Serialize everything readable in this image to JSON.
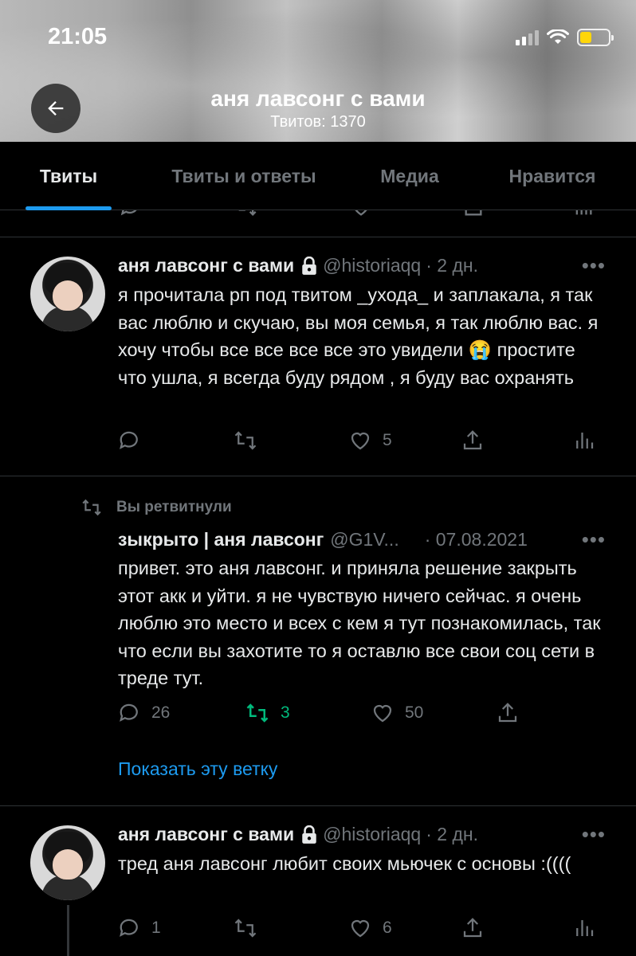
{
  "status_bar": {
    "time": "21:05"
  },
  "header": {
    "title": "аня лавсонг с вами",
    "subtitle": "Твитов: 1370"
  },
  "tabs": [
    {
      "label": "Твиты",
      "active": true
    },
    {
      "label": "Твиты и ответы",
      "active": false
    },
    {
      "label": "Медиа",
      "active": false
    },
    {
      "label": "Нравится",
      "active": false
    }
  ],
  "tweets": [
    {
      "name": "аня лавсонг с вами",
      "handle": "@historiaqq",
      "time": "· 2 дн.",
      "locked": true,
      "text": "я прочитала рп под твитом _ухода_ и заплакала, я так вас люблю и скучаю, вы  моя семья, я так люблю вас. я хочу чтобы все все все все это увидели 😭 простите что ушла, я всегда буду рядом , я буду вас охранять",
      "replies": "",
      "retweets": "",
      "likes": "5"
    },
    {
      "retweet_label": "Вы ретвитнули",
      "name": "зыкрыто | аня лавсонг",
      "handle": "@G1V...",
      "time": "· 07.08.2021",
      "text": "привет. это аня лавсонг. и приняла решение закрыть этот акк и уйти. я не чувствую ничего сейчас. я очень люблю это место и всех с кем я тут познакомилась, так что если вы захотите то я оставлю все свои соц сети в треде тут.",
      "replies": "26",
      "retweets": "3",
      "likes": "50",
      "show_thread": "Показать эту ветку"
    },
    {
      "name": "аня лавсонг с вами",
      "handle": "@historiaqq",
      "time": "· 2 дн.",
      "locked": true,
      "text": "тред аня лавсонг любит своих мьючек с основы :((((",
      "replies": "1",
      "retweets": "",
      "likes": "6"
    }
  ],
  "colors": {
    "accent": "#1d9bf0",
    "retweet_green": "#00ba7c",
    "muted": "#71767b",
    "background": "#000000"
  },
  "icons": [
    "back-arrow-icon",
    "lock-icon",
    "reply-icon",
    "retweet-icon",
    "like-icon",
    "share-icon",
    "analytics-icon",
    "more-icon",
    "signal-icon",
    "wifi-icon",
    "battery-icon"
  ]
}
